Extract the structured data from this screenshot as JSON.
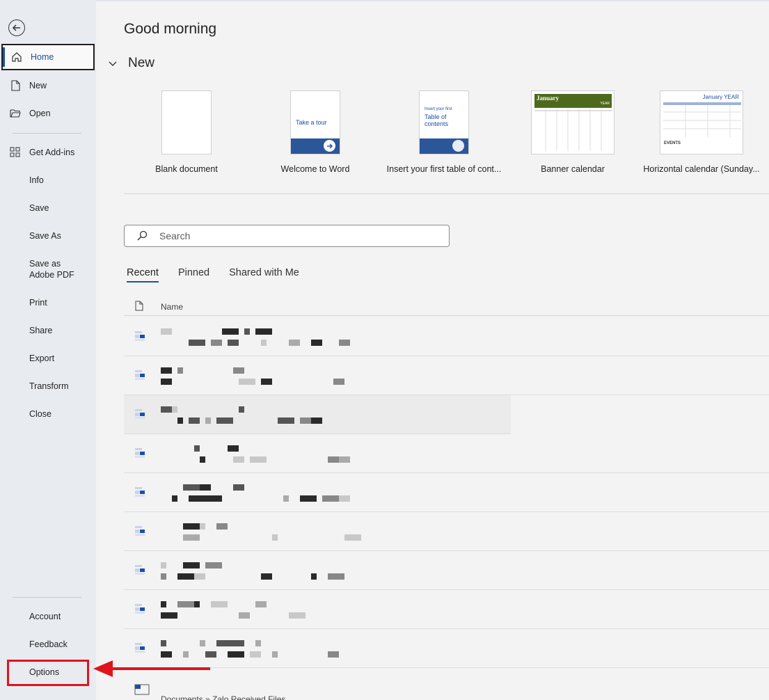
{
  "sidebar": {
    "items": [
      {
        "label": "Home"
      },
      {
        "label": "New"
      },
      {
        "label": "Open"
      },
      {
        "label": "Get Add-ins"
      },
      {
        "label": "Info"
      },
      {
        "label": "Save"
      },
      {
        "label": "Save As"
      },
      {
        "label": "Save as Adobe PDF"
      },
      {
        "label": "Print"
      },
      {
        "label": "Share"
      },
      {
        "label": "Export"
      },
      {
        "label": "Transform"
      },
      {
        "label": "Close"
      }
    ],
    "bottom": [
      {
        "label": "Account"
      },
      {
        "label": "Feedback"
      },
      {
        "label": "Options"
      }
    ]
  },
  "main": {
    "greeting": "Good morning",
    "new_section": "New",
    "templates": [
      {
        "caption": "Blank document"
      },
      {
        "caption": "Welcome to Word",
        "thumb_text": "Take a tour"
      },
      {
        "caption": "Insert your first table of cont...",
        "thumb_small": "Insert your first",
        "thumb_text": "Table of contents"
      },
      {
        "caption": "Banner calendar",
        "thumb_text": "January",
        "thumb_side": "YEAR"
      },
      {
        "caption": "Horizontal calendar (Sunday...",
        "thumb_text": "January YEAR",
        "thumb_events": "EVENTS"
      }
    ],
    "search_placeholder": "Search",
    "tabs": [
      "Recent",
      "Pinned",
      "Shared with Me"
    ],
    "list_header": "Name",
    "last_path": "Documents » Zalo Received Files"
  },
  "colors": {
    "accent": "#1e4ea5",
    "highlight": "#e0141c"
  }
}
